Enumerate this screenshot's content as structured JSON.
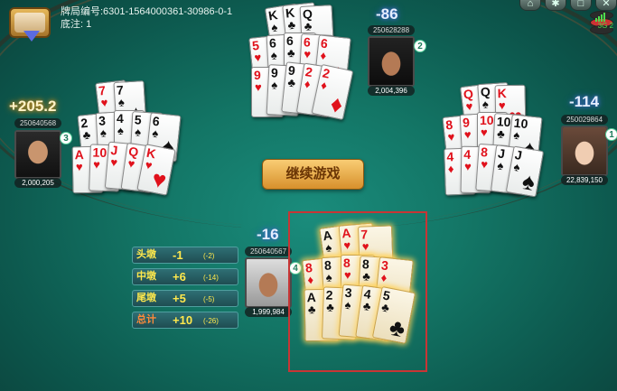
{
  "round": {
    "id_label": "牌局编号:6301-1564000361-30986-0-1",
    "base_label": "底注: 1"
  },
  "top_icons": [
    "⌂",
    "✱",
    "□",
    "✕"
  ],
  "network": {
    "label": "3G 2"
  },
  "continue_button": {
    "label": "继续游戏"
  },
  "players": {
    "left": {
      "id": "250640568",
      "coins": "2,000,205",
      "score": "+205.2",
      "seat": "3",
      "cards": [
        {
          "rank": "7",
          "suit": "♥",
          "color": "red"
        },
        {
          "rank": "7",
          "suit": "♠",
          "color": "blk"
        },
        {
          "rank": "2",
          "suit": "♣",
          "color": "blk"
        },
        {
          "rank": "3",
          "suit": "♠",
          "color": "blk"
        },
        {
          "rank": "4",
          "suit": "♠",
          "color": "blk"
        },
        {
          "rank": "5",
          "suit": "♠",
          "color": "blk"
        },
        {
          "rank": "6",
          "suit": "♠",
          "color": "blk"
        },
        {
          "rank": "A",
          "suit": "♥",
          "color": "red"
        },
        {
          "rank": "10",
          "suit": "♥",
          "color": "red"
        },
        {
          "rank": "J",
          "suit": "♥",
          "color": "red"
        },
        {
          "rank": "Q",
          "suit": "♥",
          "color": "red"
        },
        {
          "rank": "K",
          "suit": "♥",
          "color": "red"
        }
      ]
    },
    "top": {
      "id": "250628288",
      "coins": "2,004,396",
      "score": "-86",
      "seat": "2",
      "cards": [
        {
          "rank": "K",
          "suit": "♠",
          "color": "blk"
        },
        {
          "rank": "K",
          "suit": "♣",
          "color": "blk"
        },
        {
          "rank": "Q",
          "suit": "♣",
          "color": "blk"
        },
        {
          "rank": "5",
          "suit": "♥",
          "color": "red"
        },
        {
          "rank": "6",
          "suit": "♠",
          "color": "blk"
        },
        {
          "rank": "6",
          "suit": "♣",
          "color": "blk"
        },
        {
          "rank": "6",
          "suit": "♥",
          "color": "red"
        },
        {
          "rank": "6",
          "suit": "♦",
          "color": "red"
        },
        {
          "rank": "9",
          "suit": "♥",
          "color": "red"
        },
        {
          "rank": "9",
          "suit": "♠",
          "color": "blk"
        },
        {
          "rank": "9",
          "suit": "♣",
          "color": "blk"
        },
        {
          "rank": "2",
          "suit": "♦",
          "color": "red"
        },
        {
          "rank": "2",
          "suit": "♦",
          "color": "red"
        }
      ]
    },
    "right": {
      "id": "250029864",
      "coins": "22,839,150",
      "score": "-114",
      "seat": "1",
      "cards": [
        {
          "rank": "Q",
          "suit": "♥",
          "color": "red"
        },
        {
          "rank": "Q",
          "suit": "♠",
          "color": "blk"
        },
        {
          "rank": "K",
          "suit": "♥",
          "color": "red"
        },
        {
          "rank": "8",
          "suit": "♥",
          "color": "red"
        },
        {
          "rank": "9",
          "suit": "♥",
          "color": "red"
        },
        {
          "rank": "10",
          "suit": "♥",
          "color": "red"
        },
        {
          "rank": "10",
          "suit": "♣",
          "color": "blk"
        },
        {
          "rank": "10",
          "suit": "♠",
          "color": "blk"
        },
        {
          "rank": "4",
          "suit": "♦",
          "color": "red"
        },
        {
          "rank": "4",
          "suit": "♥",
          "color": "red"
        },
        {
          "rank": "8",
          "suit": "♥",
          "color": "red"
        },
        {
          "rank": "J",
          "suit": "♠",
          "color": "blk"
        },
        {
          "rank": "J",
          "suit": "♠",
          "color": "blk"
        }
      ]
    },
    "me": {
      "id": "250640567",
      "coins": "1,999,984",
      "score": "-16",
      "seat": "4",
      "cards": [
        {
          "rank": "A",
          "suit": "♠",
          "color": "blk"
        },
        {
          "rank": "A",
          "suit": "♥",
          "color": "red"
        },
        {
          "rank": "7",
          "suit": "♥",
          "color": "red"
        },
        {
          "rank": "8",
          "suit": "♦",
          "color": "red"
        },
        {
          "rank": "8",
          "suit": "♠",
          "color": "blk"
        },
        {
          "rank": "8",
          "suit": "♥",
          "color": "red"
        },
        {
          "rank": "8",
          "suit": "♣",
          "color": "blk"
        },
        {
          "rank": "3",
          "suit": "♦",
          "color": "red"
        },
        {
          "rank": "A",
          "suit": "♣",
          "color": "blk"
        },
        {
          "rank": "2",
          "suit": "♣",
          "color": "blk"
        },
        {
          "rank": "3",
          "suit": "♠",
          "color": "blk"
        },
        {
          "rank": "4",
          "suit": "♣",
          "color": "blk"
        },
        {
          "rank": "5",
          "suit": "♣",
          "color": "blk"
        }
      ]
    }
  },
  "results": [
    {
      "label": "头墩",
      "points": "-1",
      "detail": "(-2)"
    },
    {
      "label": "中墩",
      "points": "+6",
      "detail": "(-14)"
    },
    {
      "label": "尾墩",
      "points": "+5",
      "detail": "(-5)"
    },
    {
      "label": "总计",
      "points": "+10",
      "detail": "(-26)"
    }
  ],
  "colors": {
    "felt": "#137565",
    "gold_button": "#d7902c",
    "selection": "#c83535"
  }
}
